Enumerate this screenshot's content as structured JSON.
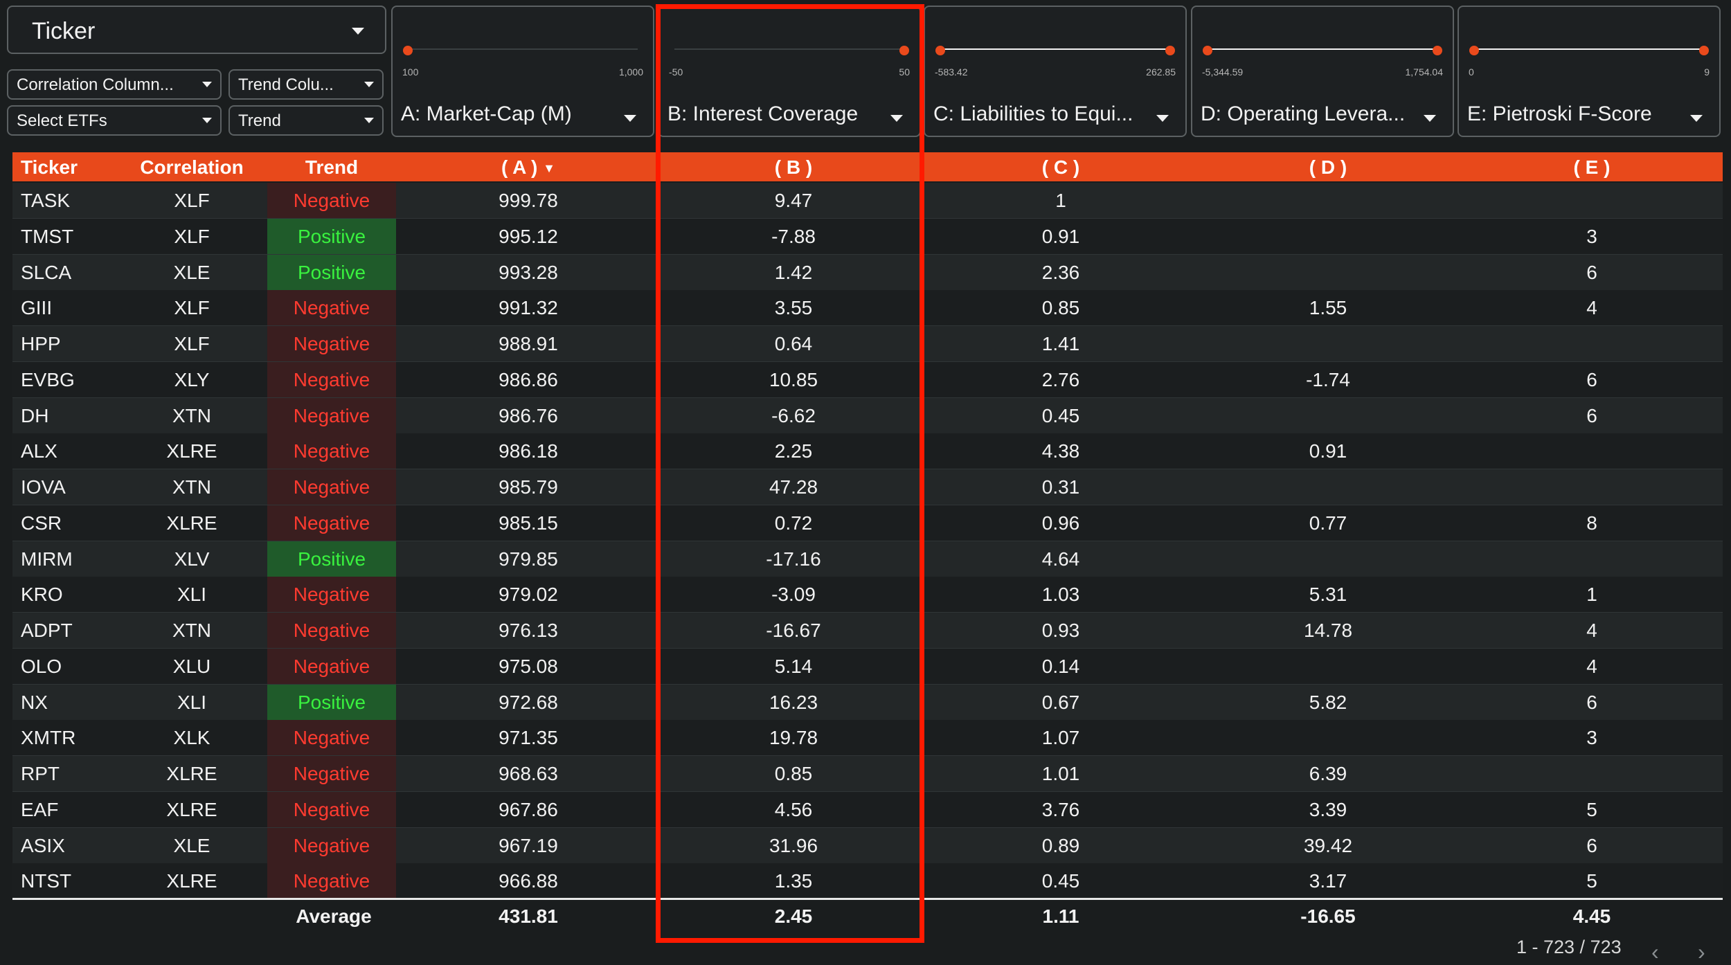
{
  "ticker_select": {
    "label": "Ticker"
  },
  "small_dropdowns": {
    "correlation_column": "Correlation Column...",
    "trend_column": "Trend Colu...",
    "select_etfs": "Select ETFs",
    "trend": "Trend"
  },
  "filters": [
    {
      "letter": "A",
      "name": ": Market-Cap (M)",
      "min": "100",
      "max": "1,000",
      "low_pct": 0,
      "high_pct": 100,
      "range_active": false
    },
    {
      "letter": "B",
      "name": ": Interest Coverage",
      "min": "-50",
      "max": "50",
      "low_pct": 100,
      "high_pct": 100,
      "range_active": false
    },
    {
      "letter": "C",
      "name": ": Liabilities to Equi...",
      "min": "-583.42",
      "max": "262.85",
      "low_pct": 0,
      "high_pct": 100,
      "range_active": true
    },
    {
      "letter": "D",
      "name": ": Operating Levera...",
      "min": "-5,344.59",
      "max": "1,754.04",
      "low_pct": 0,
      "high_pct": 100,
      "range_active": true
    },
    {
      "letter": "E",
      "name": ": Pietroski F-Score",
      "min": "0",
      "max": "9",
      "low_pct": 0,
      "high_pct": 100,
      "range_active": true
    }
  ],
  "table": {
    "headers": {
      "ticker": "Ticker",
      "correlation": "Correlation",
      "trend": "Trend",
      "a": "( A )",
      "b": "( B )",
      "c": "( C )",
      "d": "( D )",
      "e": "( E )"
    },
    "sort_indicator": "▼",
    "rows": [
      {
        "ticker": "TASK",
        "corr": "XLF",
        "trend": "Negative",
        "a": "999.78",
        "b": "9.47",
        "c": "1",
        "d": "",
        "e": ""
      },
      {
        "ticker": "TMST",
        "corr": "XLF",
        "trend": "Positive",
        "a": "995.12",
        "b": "-7.88",
        "c": "0.91",
        "d": "",
        "e": "3"
      },
      {
        "ticker": "SLCA",
        "corr": "XLE",
        "trend": "Positive",
        "a": "993.28",
        "b": "1.42",
        "c": "2.36",
        "d": "",
        "e": "6"
      },
      {
        "ticker": "GIII",
        "corr": "XLF",
        "trend": "Negative",
        "a": "991.32",
        "b": "3.55",
        "c": "0.85",
        "d": "1.55",
        "e": "4"
      },
      {
        "ticker": "HPP",
        "corr": "XLF",
        "trend": "Negative",
        "a": "988.91",
        "b": "0.64",
        "c": "1.41",
        "d": "",
        "e": ""
      },
      {
        "ticker": "EVBG",
        "corr": "XLY",
        "trend": "Negative",
        "a": "986.86",
        "b": "10.85",
        "c": "2.76",
        "d": "-1.74",
        "e": "6"
      },
      {
        "ticker": "DH",
        "corr": "XTN",
        "trend": "Negative",
        "a": "986.76",
        "b": "-6.62",
        "c": "0.45",
        "d": "",
        "e": "6"
      },
      {
        "ticker": "ALX",
        "corr": "XLRE",
        "trend": "Negative",
        "a": "986.18",
        "b": "2.25",
        "c": "4.38",
        "d": "0.91",
        "e": ""
      },
      {
        "ticker": "IOVA",
        "corr": "XTN",
        "trend": "Negative",
        "a": "985.79",
        "b": "47.28",
        "c": "0.31",
        "d": "",
        "e": ""
      },
      {
        "ticker": "CSR",
        "corr": "XLRE",
        "trend": "Negative",
        "a": "985.15",
        "b": "0.72",
        "c": "0.96",
        "d": "0.77",
        "e": "8"
      },
      {
        "ticker": "MIRM",
        "corr": "XLV",
        "trend": "Positive",
        "a": "979.85",
        "b": "-17.16",
        "c": "4.64",
        "d": "",
        "e": ""
      },
      {
        "ticker": "KRO",
        "corr": "XLI",
        "trend": "Negative",
        "a": "979.02",
        "b": "-3.09",
        "c": "1.03",
        "d": "5.31",
        "e": "1"
      },
      {
        "ticker": "ADPT",
        "corr": "XTN",
        "trend": "Negative",
        "a": "976.13",
        "b": "-16.67",
        "c": "0.93",
        "d": "14.78",
        "e": "4"
      },
      {
        "ticker": "OLO",
        "corr": "XLU",
        "trend": "Negative",
        "a": "975.08",
        "b": "5.14",
        "c": "0.14",
        "d": "",
        "e": "4"
      },
      {
        "ticker": "NX",
        "corr": "XLI",
        "trend": "Positive",
        "a": "972.68",
        "b": "16.23",
        "c": "0.67",
        "d": "5.82",
        "e": "6"
      },
      {
        "ticker": "XMTR",
        "corr": "XLK",
        "trend": "Negative",
        "a": "971.35",
        "b": "19.78",
        "c": "1.07",
        "d": "",
        "e": "3"
      },
      {
        "ticker": "RPT",
        "corr": "XLRE",
        "trend": "Negative",
        "a": "968.63",
        "b": "0.85",
        "c": "1.01",
        "d": "6.39",
        "e": ""
      },
      {
        "ticker": "EAF",
        "corr": "XLRE",
        "trend": "Negative",
        "a": "967.86",
        "b": "4.56",
        "c": "3.76",
        "d": "3.39",
        "e": "5"
      },
      {
        "ticker": "ASIX",
        "corr": "XLE",
        "trend": "Negative",
        "a": "967.19",
        "b": "31.96",
        "c": "0.89",
        "d": "39.42",
        "e": "6"
      },
      {
        "ticker": "NTST",
        "corr": "XLRE",
        "trend": "Negative",
        "a": "966.88",
        "b": "1.35",
        "c": "0.45",
        "d": "3.17",
        "e": "5"
      }
    ],
    "average": {
      "label": "Average",
      "a": "431.81",
      "b": "2.45",
      "c": "1.11",
      "d": "-16.65",
      "e": "4.45"
    }
  },
  "pagination": {
    "text": "1 - 723 / 723",
    "prev": "‹",
    "next": "›"
  },
  "colors": {
    "accent": "#e8491b",
    "highlight": "#ff1a00",
    "negative": "#ff3b30",
    "positive": "#39f23f"
  }
}
